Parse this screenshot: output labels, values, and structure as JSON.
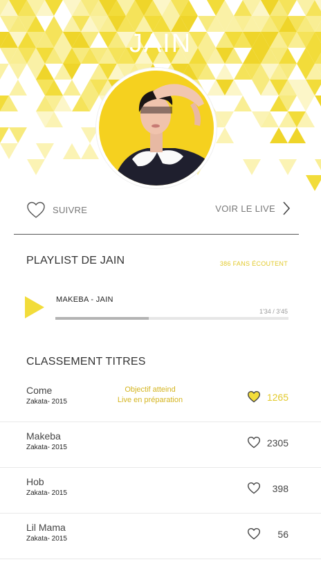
{
  "artist": {
    "name": "JAIN"
  },
  "actions": {
    "follow_label": "SUIVRE",
    "live_label": "VOIR LE LIVE"
  },
  "playlist": {
    "title": "PLAYLIST DE JAIN",
    "fans": "386 FANS ÉCOUTENT",
    "track": {
      "title": "MAKEBA - JAIN",
      "time": "1'34 / 3'45",
      "progress": 0.4
    }
  },
  "ranking": {
    "title": "CLASSEMENT TITRES",
    "rows": [
      {
        "name": "Come",
        "album": "Zakata- 2015",
        "count": "1265",
        "liked": true,
        "note_line1": "Objectif atteind",
        "note_line2": "Live en préparation"
      },
      {
        "name": "Makeba",
        "album": "Zakata- 2015",
        "count": "2305",
        "liked": false
      },
      {
        "name": "Hob",
        "album": "Zakata- 2015",
        "count": "398",
        "liked": false
      },
      {
        "name": "Lil Mama",
        "album": "Zakata- 2015",
        "count": "56",
        "liked": false
      }
    ]
  },
  "colors": {
    "accent": "#f2dc3a",
    "accent_text": "#e2c92a",
    "note": "#d4b41f"
  },
  "icons": {
    "follow": "heart-outline-icon",
    "live": "chevron-right-icon",
    "play": "play-triangle-icon",
    "like": "heart-icon"
  }
}
